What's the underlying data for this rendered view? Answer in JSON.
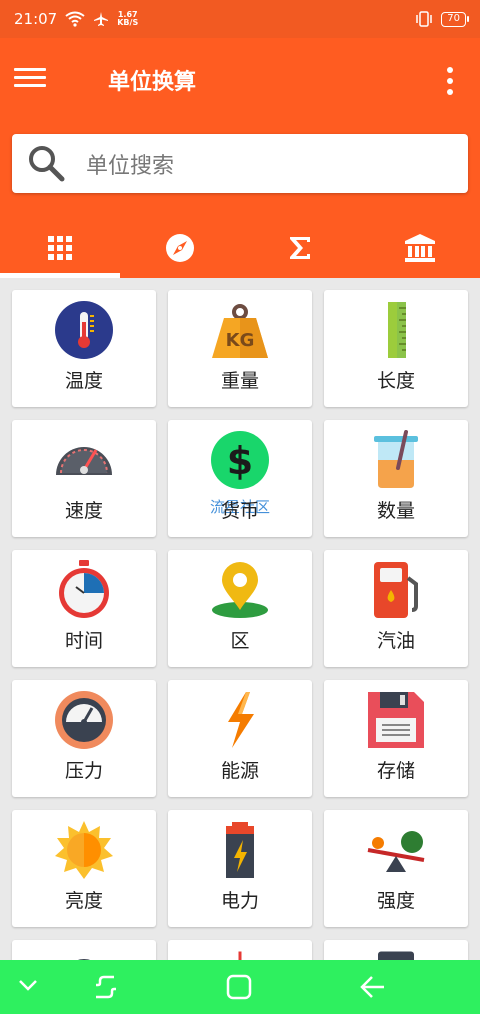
{
  "status_bar": {
    "time": "21:07",
    "speed_value": "1.67",
    "speed_unit": "KB/S",
    "battery": "70"
  },
  "app_bar": {
    "title": "单位换算"
  },
  "search": {
    "placeholder": "单位搜索"
  },
  "tabs": [
    {
      "icon": "grid-icon",
      "active": true
    },
    {
      "icon": "compass-icon",
      "active": false
    },
    {
      "icon": "sigma-icon",
      "active": false
    },
    {
      "icon": "bank-icon",
      "active": false
    }
  ],
  "categories": [
    {
      "label": "温度",
      "icon": "thermometer-icon"
    },
    {
      "label": "重量",
      "icon": "weight-icon"
    },
    {
      "label": "长度",
      "icon": "ruler-icon"
    },
    {
      "label": "速度",
      "icon": "speedometer-icon"
    },
    {
      "label": "货币",
      "icon": "dollar-icon"
    },
    {
      "label": "数量",
      "icon": "beaker-icon"
    },
    {
      "label": "时间",
      "icon": "stopwatch-icon"
    },
    {
      "label": "区",
      "icon": "map-pin-icon"
    },
    {
      "label": "汽油",
      "icon": "fuel-pump-icon"
    },
    {
      "label": "压力",
      "icon": "pressure-gauge-icon"
    },
    {
      "label": "能源",
      "icon": "lightning-icon"
    },
    {
      "label": "存储",
      "icon": "floppy-disk-icon"
    },
    {
      "label": "亮度",
      "icon": "sun-icon"
    },
    {
      "label": "电力",
      "icon": "battery-icon"
    },
    {
      "label": "强度",
      "icon": "seesaw-icon"
    }
  ],
  "watermark": "流星社区",
  "colors": {
    "accent": "#ff5c21",
    "nav_bar": "#2ef05f"
  }
}
